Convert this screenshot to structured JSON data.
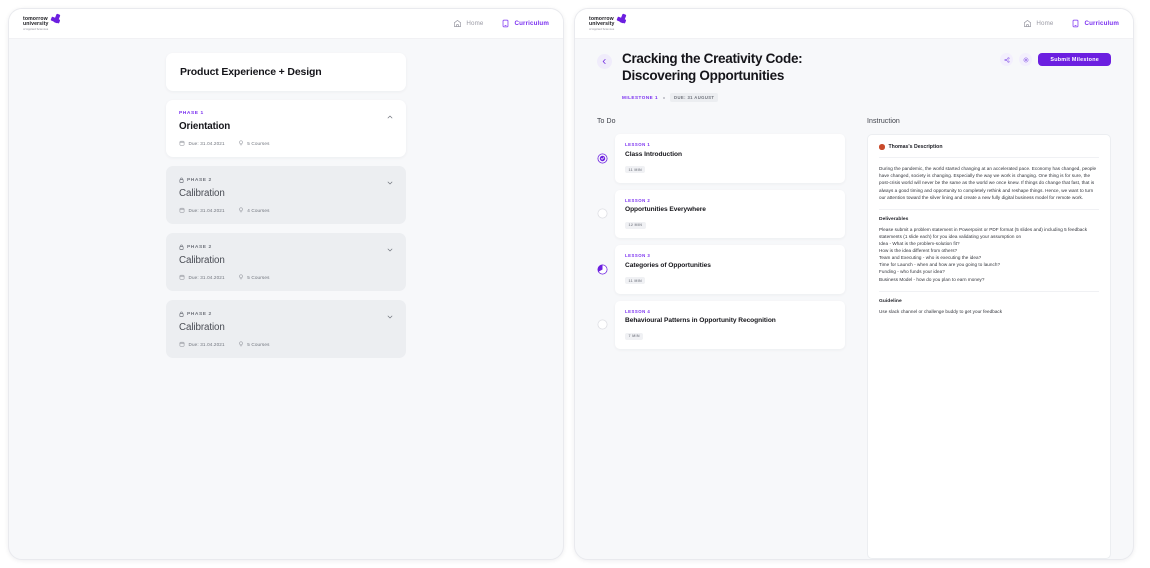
{
  "brand": {
    "logo_line1": "tomorrow",
    "logo_line2": "university",
    "logo_line3": "of Applied Sciences",
    "accent": "#6c1fe0",
    "accent_light": "#7a2ff0"
  },
  "nav": {
    "home_label": "Home",
    "home_icon": "house-icon",
    "curriculum_label": "Curriculum",
    "curriculum_icon": "book-icon"
  },
  "left_window": {
    "program_title": "Product Experience + Design",
    "phases": [
      {
        "kicker": "PHASE 1",
        "name": "Orientation",
        "due": "Due: 31.04.2021",
        "courses": "5 Courses",
        "locked": false,
        "expanded": true
      },
      {
        "kicker": "PHASE 2",
        "name": "Calibration",
        "due": "Due: 31.04.2021",
        "courses": "4 Courses",
        "locked": true,
        "expanded": false
      },
      {
        "kicker": "PHASE 2",
        "name": "Calibration",
        "due": "Due: 31.04.2021",
        "courses": "5 Courses",
        "locked": true,
        "expanded": false
      },
      {
        "kicker": "PHASE 2",
        "name": "Calibration",
        "due": "Due: 31.04.2021",
        "courses": "5 Courses",
        "locked": true,
        "expanded": false
      }
    ]
  },
  "right_window": {
    "back_icon": "arrow-left-icon",
    "title": "Cracking the Creativity Code: Discovering Opportunities",
    "milestone_label": "MILESTONE 1",
    "due_pill": "DUE: 31 AUGUST",
    "action_icons": [
      "share-icon",
      "bookmark-icon"
    ],
    "submit_label": "Submit Milestone",
    "todo_heading": "To Do",
    "instruction_heading": "Instruction",
    "lessons": [
      {
        "kicker": "LESSON 1",
        "name": "Class Introduction",
        "duration": "11 MIN",
        "status": "complete"
      },
      {
        "kicker": "LESSON 2",
        "name": "Opportunities Everywhere",
        "duration": "12 MIN",
        "status": "empty"
      },
      {
        "kicker": "LESSON 3",
        "name": "Categories of Opportunities",
        "duration": "11 MIN",
        "status": "partial"
      },
      {
        "kicker": "LESSON 4",
        "name": "Behavioural Patterns in Opportunity Recognition",
        "duration": "7 MIN",
        "status": "empty"
      }
    ],
    "instruction": {
      "author": "Thomas's Description",
      "author_avatar": "avatar-icon",
      "description": "During the pandemic, the world started changing at an accelerated pace. Economy has changed, people have changed, society is changing. Especially the way we work is changing. One thing is for sure, the post-crisis world will never be the same as the world we once knew. If things do change that fast, that is always a good timing and opportunity to completely rethink and reshape things. Hence, we want to turn our attention toward the silver lining and create a new fully digital business model for remote work.",
      "deliverables_heading": "Deliverables",
      "deliverables_body": "Please submit a problem statement in Powerpoint or PDF format (5 slides and) including 5 feedback statements (1 slide each) for you idea validating your assumption on\nIdea - What is the problem-solution fit?\nHow is the idea different from others?\nTeam and Executing - who is executing the idea?\nTime for Launch - when and how are you going to launch?\nFunding - who funds your idea?\nBusiness Model - how do you plan to earn money?",
      "guideline_heading": "Guideline",
      "guideline_body": "Use slack channel or challenge buddy to get your feedback"
    }
  }
}
